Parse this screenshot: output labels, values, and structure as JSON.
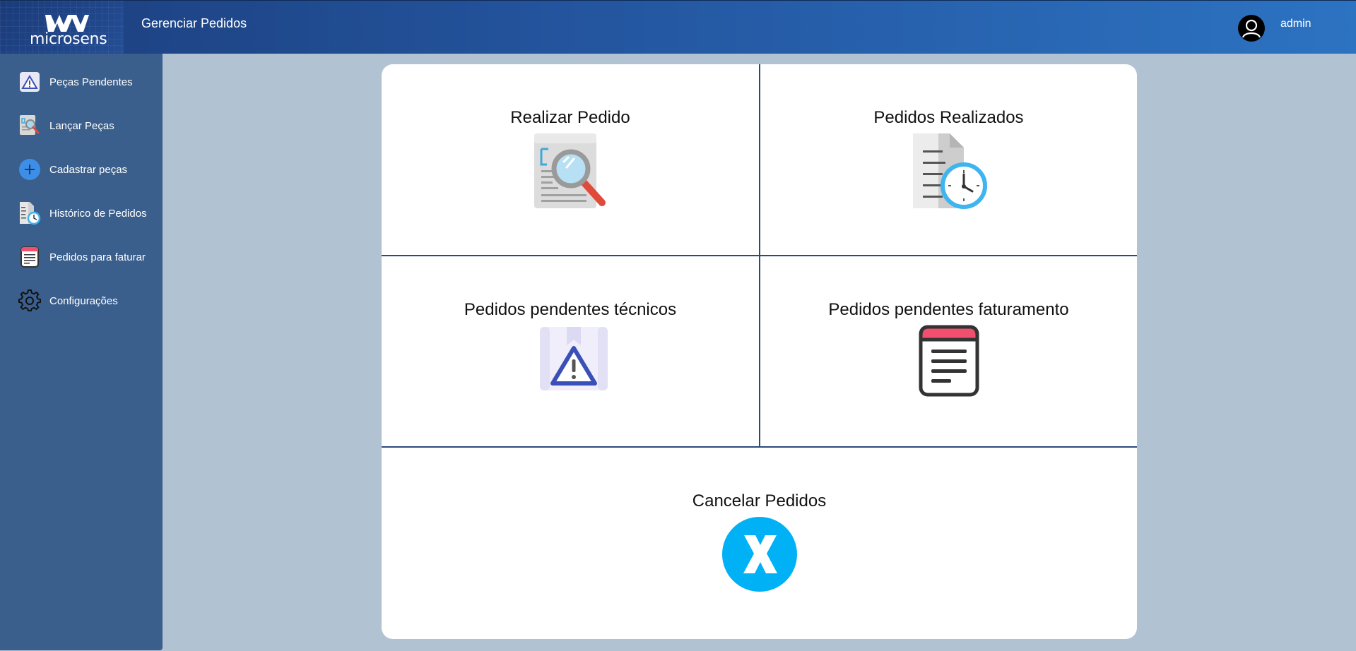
{
  "header": {
    "logo_text": "microsens",
    "title": "Gerenciar Pedidos",
    "username": "admin"
  },
  "sidebar": {
    "items": [
      {
        "label": "Peças Pendentes",
        "icon": "warning-icon"
      },
      {
        "label": "Lançar Peças",
        "icon": "search-document-icon"
      },
      {
        "label": "Cadastrar peças",
        "icon": "plus-circle-icon"
      },
      {
        "label": "Histórico de Pedidos",
        "icon": "history-document-icon"
      },
      {
        "label": "Pedidos para faturar",
        "icon": "invoice-icon"
      },
      {
        "label": "Configurações",
        "icon": "gear-icon"
      }
    ]
  },
  "main": {
    "tiles": [
      {
        "label": "Realizar Pedido",
        "icon": "search-document-icon"
      },
      {
        "label": "Pedidos Realizados",
        "icon": "history-document-icon"
      },
      {
        "label": "Pedidos pendentes técnicos",
        "icon": "warning-icon"
      },
      {
        "label": "Pedidos pendentes faturamento",
        "icon": "invoice-icon"
      },
      {
        "label": "Cancelar Pedidos",
        "icon": "cancel-x-icon"
      }
    ]
  },
  "colors": {
    "header_start": "#1c3f7e",
    "header_end": "#2c73c2",
    "sidebar": "#3b5f8c",
    "background": "#b1c2d3",
    "divider": "#2a4a7a",
    "cancel": "#00b2f5",
    "invoice_red": "#f0506e"
  }
}
